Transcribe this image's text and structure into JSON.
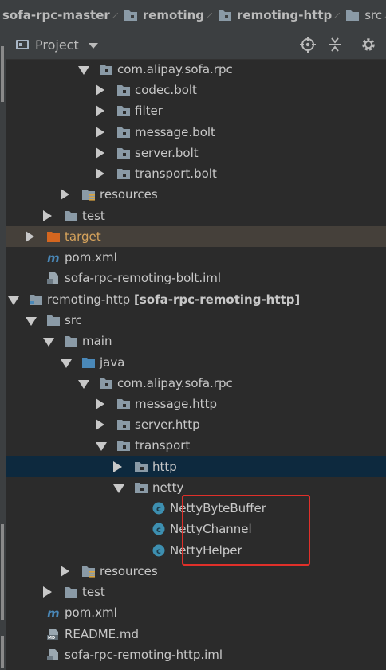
{
  "breadcrumb": {
    "items": [
      {
        "label": "sofa-rpc-master",
        "icon": "folder-icon"
      },
      {
        "label": "remoting",
        "icon": "folder-icon"
      },
      {
        "label": "remoting-http",
        "icon": "folder-icon"
      },
      {
        "label": "src",
        "icon": "folder-icon"
      }
    ]
  },
  "toolbar": {
    "title": "Project",
    "buttons": [
      "locate-icon",
      "collapse-all-icon",
      "settings-icon"
    ]
  },
  "tree": {
    "rows": [
      {
        "label": "com.alipay.sofa.rpc",
        "icon": "package-icon",
        "state": "expanded"
      },
      {
        "label": "codec.bolt",
        "icon": "package-icon",
        "state": "collapsed"
      },
      {
        "label": "filter",
        "icon": "package-icon",
        "state": "collapsed"
      },
      {
        "label": "message.bolt",
        "icon": "package-icon",
        "state": "collapsed"
      },
      {
        "label": "server.bolt",
        "icon": "package-icon",
        "state": "collapsed"
      },
      {
        "label": "transport.bolt",
        "icon": "package-icon",
        "state": "collapsed"
      },
      {
        "label": "resources",
        "icon": "resources-folder-icon",
        "state": "collapsed"
      },
      {
        "label": "test",
        "icon": "folder-icon",
        "state": "collapsed"
      },
      {
        "label": "target",
        "icon": "excluded-folder-icon",
        "state": "collapsed"
      },
      {
        "label": "pom.xml",
        "icon": "maven-icon",
        "state": "none"
      },
      {
        "label": "sofa-rpc-remoting-bolt.iml",
        "icon": "iml-file-icon",
        "state": "none"
      },
      {
        "label": "remoting-http",
        "label_suffix": "[sofa-rpc-remoting-http]",
        "icon": "module-folder-icon",
        "state": "expanded"
      },
      {
        "label": "src",
        "icon": "folder-icon",
        "state": "expanded"
      },
      {
        "label": "main",
        "icon": "folder-icon",
        "state": "expanded"
      },
      {
        "label": "java",
        "icon": "source-folder-icon",
        "state": "expanded"
      },
      {
        "label": "com.alipay.sofa.rpc",
        "icon": "package-icon",
        "state": "expanded"
      },
      {
        "label": "message.http",
        "icon": "package-icon",
        "state": "collapsed"
      },
      {
        "label": "server.http",
        "icon": "package-icon",
        "state": "collapsed"
      },
      {
        "label": "transport",
        "icon": "package-icon",
        "state": "expanded"
      },
      {
        "label": "http",
        "icon": "package-icon",
        "state": "collapsed"
      },
      {
        "label": "netty",
        "icon": "package-icon",
        "state": "expanded"
      },
      {
        "label": "NettyByteBuffer",
        "icon": "class-icon",
        "state": "none"
      },
      {
        "label": "NettyChannel",
        "icon": "class-icon",
        "state": "none"
      },
      {
        "label": "NettyHelper",
        "icon": "class-icon",
        "state": "none"
      },
      {
        "label": "resources",
        "icon": "resources-folder-icon",
        "state": "collapsed"
      },
      {
        "label": "test",
        "icon": "folder-icon",
        "state": "collapsed"
      },
      {
        "label": "pom.xml",
        "icon": "maven-icon",
        "state": "none"
      },
      {
        "label": "README.md",
        "icon": "markdown-icon",
        "state": "none"
      },
      {
        "label": "sofa-rpc-remoting-http.iml",
        "icon": "iml-file-icon",
        "state": "none"
      }
    ],
    "selected_row": 19,
    "excluded_row": 8
  },
  "colors": {
    "background": "#2b2b2b",
    "panel": "#3c3f41",
    "selection": "#0d293e",
    "excluded_row": "#45403a",
    "highlight_box": "#e0302a",
    "folder": "#8a9aa6",
    "target_folder": "#d4661f",
    "class_icon": "#3d8fb0"
  }
}
